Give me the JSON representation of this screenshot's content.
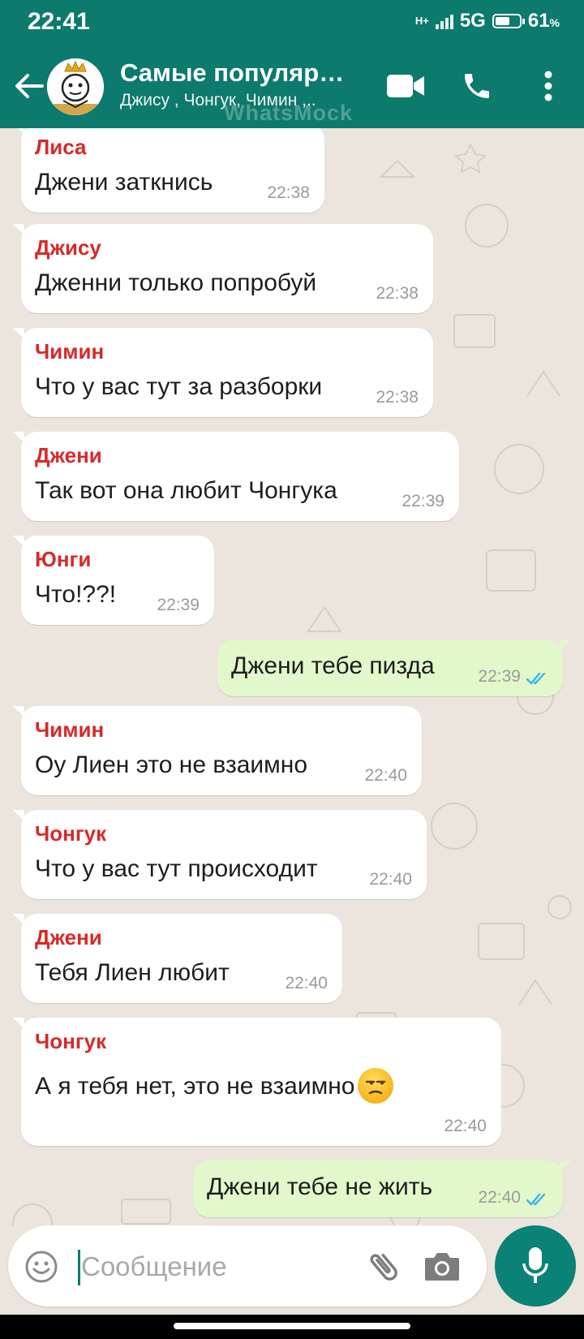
{
  "status": {
    "time": "22:41",
    "network_type": "H+",
    "network_5g": "5G",
    "battery_percent": "61",
    "battery_sign": "%",
    "battery_level": 0.61
  },
  "header": {
    "title": "Самые популяр…",
    "subtitle": "Джису , Чонгук, Чимин ,..",
    "watermark": "WhatsMock",
    "icons": [
      "back-arrow-icon",
      "video-call-icon",
      "phone-call-icon",
      "more-vert-icon"
    ]
  },
  "messages": [
    {
      "sender": "Лиса",
      "text": "Джени заткнись",
      "time": "22:38"
    },
    {
      "sender": "Джису",
      "text": "Дженни только попробуй",
      "time": "22:38"
    },
    {
      "sender": "Чимин",
      "text": "Что у вас тут за разборки",
      "time": "22:38"
    },
    {
      "sender": "Джени",
      "text": "Так вот она любит Чонгука",
      "time": "22:39"
    },
    {
      "sender": "Юнги",
      "text": "Что!??!",
      "time": "22:39"
    },
    {
      "text": "Джени тебе пизда",
      "time": "22:39",
      "outgoing": true,
      "read": true
    },
    {
      "sender": "Чимин",
      "text": "Оу Лиен это не взаимно",
      "time": "22:40"
    },
    {
      "sender": "Чонгук",
      "text": "Что у вас тут происходит",
      "time": "22:40"
    },
    {
      "sender": "Джени",
      "text": "Тебя Лиен любит",
      "time": "22:40"
    },
    {
      "sender": "Чонгук",
      "text": "А я тебя нет, это не взаимно",
      "time": "22:40",
      "emoji": "unamused-face"
    },
    {
      "text": "Джени тебе не жить",
      "time": "22:40",
      "outgoing": true,
      "read": true
    }
  ],
  "input": {
    "placeholder": "Сообщение",
    "icons": [
      "emoji-icon",
      "attach-icon",
      "camera-icon",
      "mic-icon"
    ]
  },
  "colors": {
    "header": "#0c7a6c",
    "sender_name": "#d62a2a",
    "outgoing_bubble": "#e2f8cb",
    "read_ticks": "#34b7f1",
    "chat_bg": "#ece5dd",
    "mic_button": "#0b8276"
  }
}
